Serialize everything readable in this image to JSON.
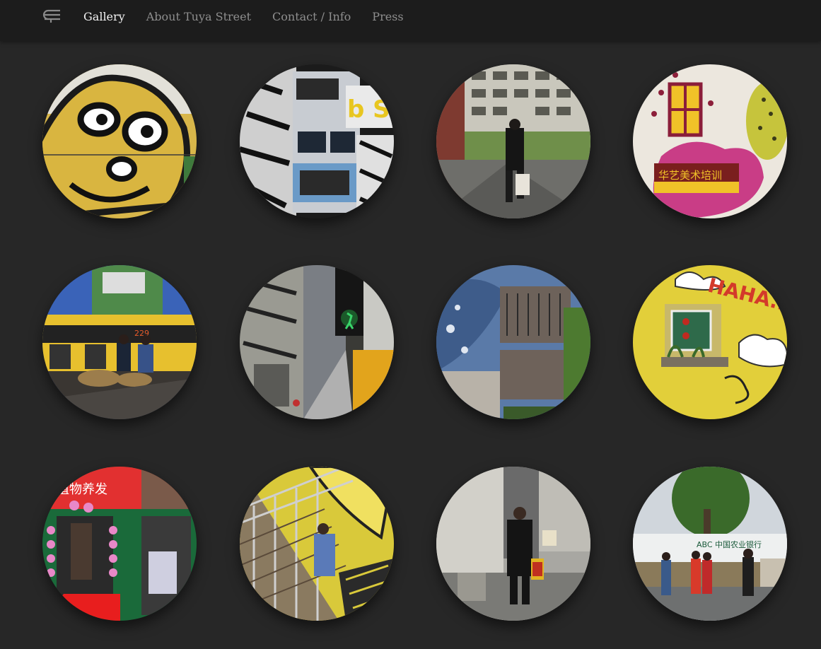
{
  "header": {
    "nav": [
      {
        "label": "Gallery",
        "active": true
      },
      {
        "label": "About Tuya Street",
        "active": false
      },
      {
        "label": "Contact / Info",
        "active": false
      },
      {
        "label": "Press",
        "active": false
      }
    ]
  },
  "gallery": {
    "columns": 4,
    "rows": 3,
    "photos": [
      {
        "name": "yellow-cartoon-face-mural",
        "text": ""
      },
      {
        "name": "black-white-graffiti-apartment",
        "text": ""
      },
      {
        "name": "man-walking-toward-apartment-block",
        "text": ""
      },
      {
        "name": "pink-mural-with-shop-sign",
        "text": "华艺美术培训"
      },
      {
        "name": "yellow-bus-street-market",
        "text": "229"
      },
      {
        "name": "pedestrian-signal-alley",
        "text": ""
      },
      {
        "name": "blue-fish-mural-balconies",
        "text": ""
      },
      {
        "name": "yellow-haha-mural-balcony",
        "text": "HAHA..."
      },
      {
        "name": "shop-entrance-pink-balloons",
        "text": "植物养发"
      },
      {
        "name": "yellow-stairway-graffiti",
        "text": ""
      },
      {
        "name": "man-in-suit-with-bag",
        "text": ""
      },
      {
        "name": "people-at-bank-street",
        "text": "ABC 中国农业银行"
      }
    ]
  },
  "colors": {
    "background": "#272727",
    "topbar": "#1c1c1c",
    "nav_active": "#f2f2f2",
    "nav_inactive": "#8e8e8e"
  }
}
